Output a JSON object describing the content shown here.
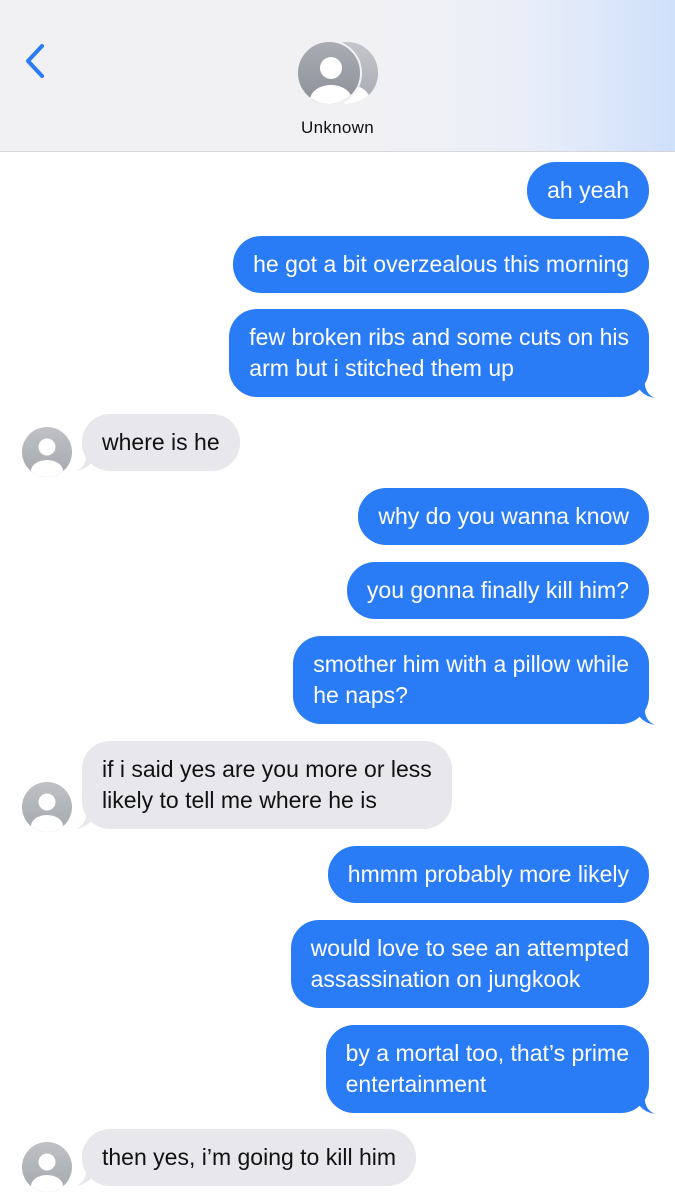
{
  "header": {
    "contact_name": "Unknown",
    "back_icon": "chevron-left-icon",
    "accent_color": "#2a7cf6"
  },
  "messages": [
    {
      "from": "me",
      "lines": [
        "ah yeah"
      ]
    },
    {
      "from": "me",
      "lines": [
        "he got a bit overzealous this morning"
      ]
    },
    {
      "from": "me",
      "lines": [
        "few broken ribs and some cuts on his",
        "arm but i stitched them up"
      ]
    },
    {
      "from": "them",
      "lines": [
        "where is he"
      ]
    },
    {
      "from": "me",
      "lines": [
        "why do you wanna know"
      ]
    },
    {
      "from": "me",
      "lines": [
        "you gonna finally kill him?"
      ]
    },
    {
      "from": "me",
      "lines": [
        "smother him with a pillow while",
        "he naps?"
      ]
    },
    {
      "from": "them",
      "lines": [
        "if i said yes are you more or less",
        "likely to tell me where he is"
      ]
    },
    {
      "from": "me",
      "lines": [
        "hmmm probably more likely"
      ]
    },
    {
      "from": "me",
      "lines": [
        "would love to see an attempted",
        "assassination on jungkook"
      ]
    },
    {
      "from": "me",
      "lines": [
        "by a mortal too, that’s prime",
        "entertainment"
      ]
    },
    {
      "from": "them",
      "lines": [
        "then yes, i’m going to kill him"
      ]
    }
  ],
  "colors": {
    "outgoing_bubble": "#2a7cf6",
    "incoming_bubble": "#e8e8ec"
  }
}
